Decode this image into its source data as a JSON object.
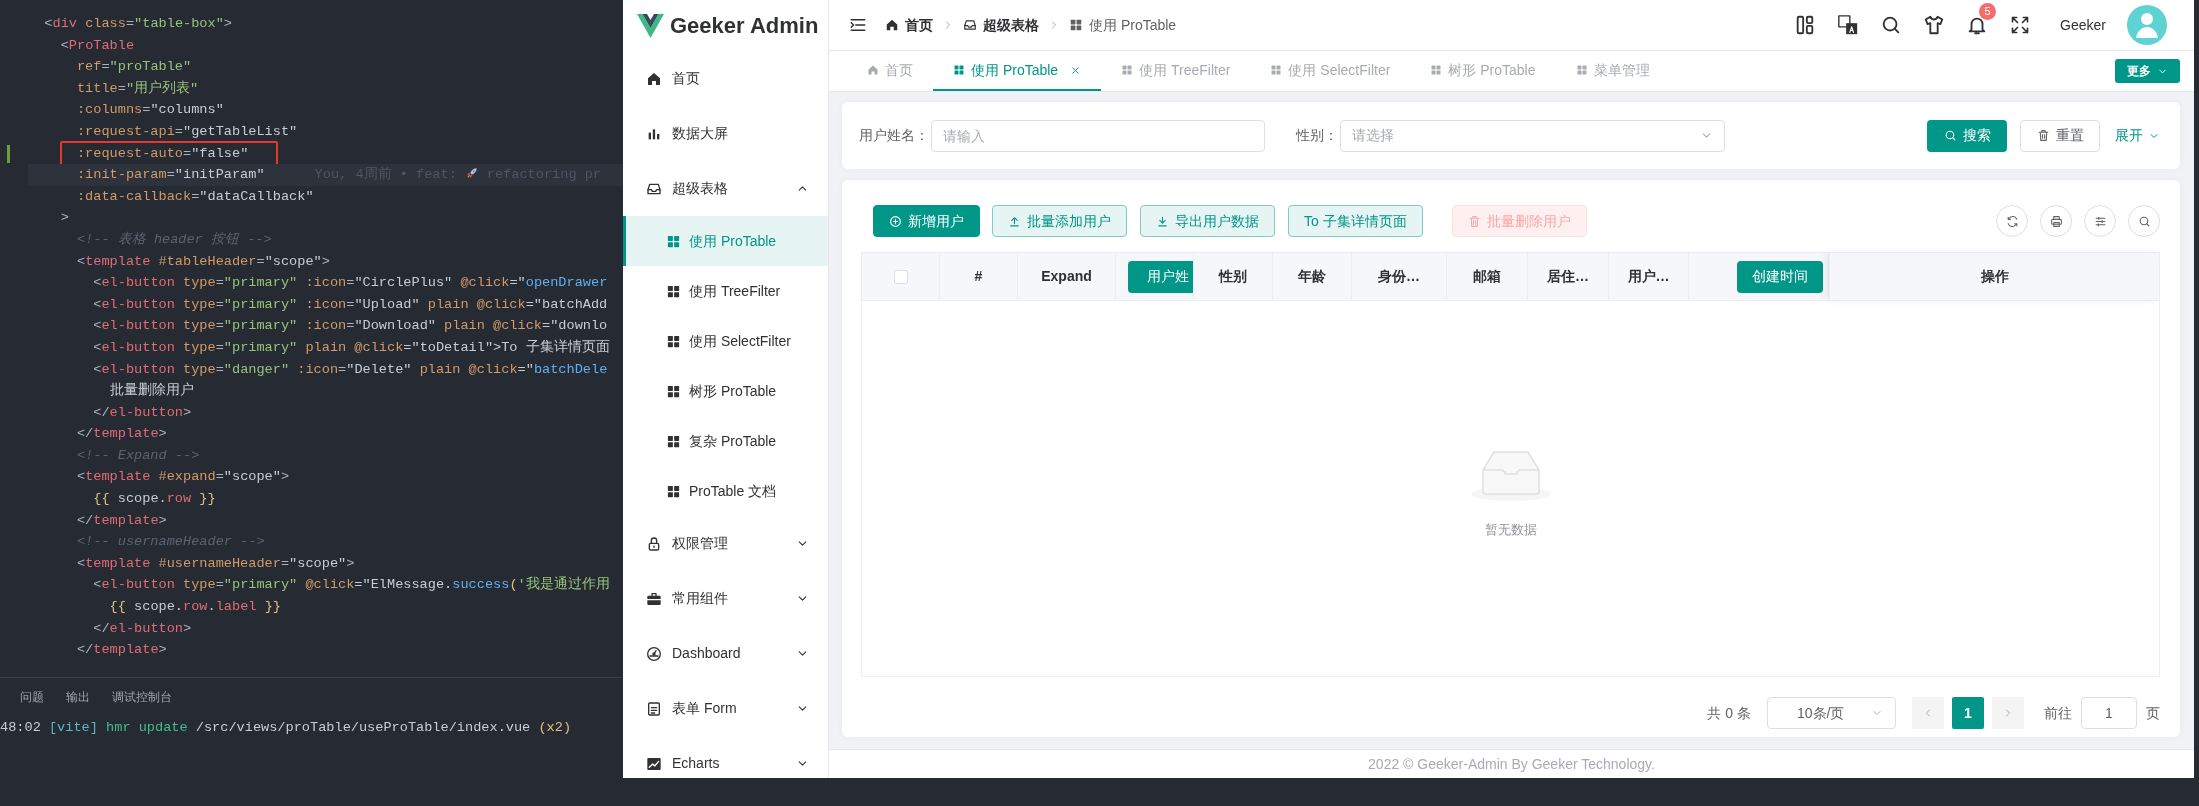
{
  "editor": {
    "lines": [
      {
        "kind": "plain",
        "segments": [
          {
            "t": "  <",
            "kind": "punct"
          },
          {
            "t": "div",
            "kind": "tag"
          },
          {
            "t": " class",
            "kind": "attr"
          },
          {
            "t": "=",
            "kind": "punct"
          },
          {
            "t": "\"table-box\"",
            "kind": "string"
          },
          {
            "t": ">",
            "kind": "punct"
          }
        ]
      },
      {
        "kind": "plain",
        "segments": [
          {
            "t": "    <",
            "kind": "punct"
          },
          {
            "t": "ProTable",
            "kind": "tag"
          }
        ]
      },
      {
        "kind": "plain",
        "segments": [
          {
            "t": "      ref",
            "kind": "attr"
          },
          {
            "t": "=",
            "kind": "punct"
          },
          {
            "t": "\"proTable\"",
            "kind": "string"
          }
        ]
      },
      {
        "kind": "plain",
        "segments": [
          {
            "t": "      title",
            "kind": "attr"
          },
          {
            "t": "=",
            "kind": "punct"
          },
          {
            "t": "\"用户列表\"",
            "kind": "string"
          }
        ]
      },
      {
        "kind": "plain",
        "segments": [
          {
            "t": "      :columns",
            "kind": "attr"
          },
          {
            "t": "=",
            "kind": "punct"
          },
          {
            "t": "\"columns\"",
            "kind": "plain"
          }
        ]
      },
      {
        "kind": "plain",
        "segments": [
          {
            "t": "      :request-api",
            "kind": "attr"
          },
          {
            "t": "=",
            "kind": "punct"
          },
          {
            "t": "\"getTableList\"",
            "kind": "plain"
          }
        ]
      },
      {
        "kind": "boxed",
        "segments": [
          {
            "t": "      :request-auto",
            "kind": "attr"
          },
          {
            "t": "=",
            "kind": "punct"
          },
          {
            "t": "\"false\"",
            "kind": "plain"
          }
        ]
      },
      {
        "kind": "current",
        "segments": [
          {
            "t": "      :init-param",
            "kind": "attr"
          },
          {
            "t": "=",
            "kind": "punct"
          },
          {
            "t": "\"initParam\"",
            "kind": "plain"
          }
        ],
        "blame": {
          "text": "You, 4周前 • feat:",
          "rest": "refactoring pr"
        }
      },
      {
        "kind": "plain",
        "segments": [
          {
            "t": "      :data-callback",
            "kind": "attr"
          },
          {
            "t": "=",
            "kind": "punct"
          },
          {
            "t": "\"dataCallback\"",
            "kind": "plain"
          }
        ]
      },
      {
        "kind": "plain",
        "segments": [
          {
            "t": "    >",
            "kind": "punct"
          }
        ]
      },
      {
        "kind": "plain",
        "segments": [
          {
            "t": "      <!-- 表格 header 按钮 -->",
            "kind": "comment"
          }
        ]
      },
      {
        "kind": "plain",
        "segments": [
          {
            "t": "      <",
            "kind": "punct"
          },
          {
            "t": "template",
            "kind": "tag"
          },
          {
            "t": " #tableHeader",
            "kind": "attr"
          },
          {
            "t": "=",
            "kind": "punct"
          },
          {
            "t": "\"scope\"",
            "kind": "plain"
          },
          {
            "t": ">",
            "kind": "punct"
          }
        ]
      },
      {
        "kind": "plain",
        "segments": [
          {
            "t": "        <",
            "kind": "punct"
          },
          {
            "t": "el-button",
            "kind": "tag"
          },
          {
            "t": " type",
            "kind": "attr"
          },
          {
            "t": "=",
            "kind": "punct"
          },
          {
            "t": "\"primary\"",
            "kind": "string"
          },
          {
            "t": " :icon",
            "kind": "attr"
          },
          {
            "t": "=",
            "kind": "punct"
          },
          {
            "t": "\"CirclePlus\"",
            "kind": "plain"
          },
          {
            "t": " @click",
            "kind": "attr"
          },
          {
            "t": "=\"",
            "kind": "plain"
          },
          {
            "t": "openDrawer",
            "kind": "function"
          }
        ]
      },
      {
        "kind": "plain",
        "segments": [
          {
            "t": "        <",
            "kind": "punct"
          },
          {
            "t": "el-button",
            "kind": "tag"
          },
          {
            "t": " type",
            "kind": "attr"
          },
          {
            "t": "=",
            "kind": "punct"
          },
          {
            "t": "\"primary\"",
            "kind": "string"
          },
          {
            "t": " :icon",
            "kind": "attr"
          },
          {
            "t": "=",
            "kind": "punct"
          },
          {
            "t": "\"Upload\"",
            "kind": "plain"
          },
          {
            "t": " plain @click",
            "kind": "attr"
          },
          {
            "t": "=\"batchAdd",
            "kind": "plain"
          }
        ]
      },
      {
        "kind": "plain",
        "segments": [
          {
            "t": "        <",
            "kind": "punct"
          },
          {
            "t": "el-button",
            "kind": "tag"
          },
          {
            "t": " type",
            "kind": "attr"
          },
          {
            "t": "=",
            "kind": "punct"
          },
          {
            "t": "\"primary\"",
            "kind": "string"
          },
          {
            "t": " :icon",
            "kind": "attr"
          },
          {
            "t": "=",
            "kind": "punct"
          },
          {
            "t": "\"Download\"",
            "kind": "plain"
          },
          {
            "t": " plain @click",
            "kind": "attr"
          },
          {
            "t": "=\"downlo",
            "kind": "plain"
          }
        ]
      },
      {
        "kind": "plain",
        "segments": [
          {
            "t": "        <",
            "kind": "punct"
          },
          {
            "t": "el-button",
            "kind": "tag"
          },
          {
            "t": " type",
            "kind": "attr"
          },
          {
            "t": "=",
            "kind": "punct"
          },
          {
            "t": "\"primary\"",
            "kind": "string"
          },
          {
            "t": " plain @click",
            "kind": "attr"
          },
          {
            "t": "=\"toDetail\">To 子集详情页面",
            "kind": "plain"
          }
        ]
      },
      {
        "kind": "plain",
        "segments": [
          {
            "t": "        <",
            "kind": "punct"
          },
          {
            "t": "el-button",
            "kind": "tag"
          },
          {
            "t": " type",
            "kind": "attr"
          },
          {
            "t": "=",
            "kind": "punct"
          },
          {
            "t": "\"danger\"",
            "kind": "string"
          },
          {
            "t": " :icon",
            "kind": "attr"
          },
          {
            "t": "=",
            "kind": "punct"
          },
          {
            "t": "\"Delete\"",
            "kind": "plain"
          },
          {
            "t": " plain @click",
            "kind": "attr"
          },
          {
            "t": "=\"",
            "kind": "plain"
          },
          {
            "t": "batchDele",
            "kind": "function"
          }
        ]
      },
      {
        "kind": "plain",
        "segments": [
          {
            "t": "          批量删除用户",
            "kind": "plain"
          }
        ]
      },
      {
        "kind": "plain",
        "segments": [
          {
            "t": "        </",
            "kind": "punct"
          },
          {
            "t": "el-button",
            "kind": "tag"
          },
          {
            "t": ">",
            "kind": "punct"
          }
        ]
      },
      {
        "kind": "plain",
        "segments": [
          {
            "t": "      </",
            "kind": "punct"
          },
          {
            "t": "template",
            "kind": "tag"
          },
          {
            "t": ">",
            "kind": "punct"
          }
        ]
      },
      {
        "kind": "plain",
        "segments": [
          {
            "t": "      <!-- Expand -->",
            "kind": "comment"
          }
        ]
      },
      {
        "kind": "plain",
        "segments": [
          {
            "t": "      <",
            "kind": "punct"
          },
          {
            "t": "template",
            "kind": "tag"
          },
          {
            "t": " #expand",
            "kind": "attr"
          },
          {
            "t": "=",
            "kind": "punct"
          },
          {
            "t": "\"scope\"",
            "kind": "plain"
          },
          {
            "t": ">",
            "kind": "punct"
          }
        ]
      },
      {
        "kind": "plain",
        "segments": [
          {
            "t": "        {{",
            "kind": "brace"
          },
          {
            "t": " scope.",
            "kind": "plain"
          },
          {
            "t": "row",
            "kind": "property"
          },
          {
            "t": " }}",
            "kind": "brace"
          }
        ]
      },
      {
        "kind": "plain",
        "segments": [
          {
            "t": "      </",
            "kind": "punct"
          },
          {
            "t": "template",
            "kind": "tag"
          },
          {
            "t": ">",
            "kind": "punct"
          }
        ]
      },
      {
        "kind": "plain",
        "segments": [
          {
            "t": "      <!-- usernameHeader -->",
            "kind": "comment"
          }
        ]
      },
      {
        "kind": "plain",
        "segments": [
          {
            "t": "      <",
            "kind": "punct"
          },
          {
            "t": "template",
            "kind": "tag"
          },
          {
            "t": " #usernameHeader",
            "kind": "attr"
          },
          {
            "t": "=",
            "kind": "punct"
          },
          {
            "t": "\"scope\"",
            "kind": "plain"
          },
          {
            "t": ">",
            "kind": "punct"
          }
        ]
      },
      {
        "kind": "plain",
        "segments": [
          {
            "t": "        <",
            "kind": "punct"
          },
          {
            "t": "el-button",
            "kind": "tag"
          },
          {
            "t": " type",
            "kind": "attr"
          },
          {
            "t": "=",
            "kind": "punct"
          },
          {
            "t": "\"primary\"",
            "kind": "string"
          },
          {
            "t": " @click",
            "kind": "attr"
          },
          {
            "t": "=\"ElMessage.",
            "kind": "plain"
          },
          {
            "t": "success",
            "kind": "function"
          },
          {
            "t": "(",
            "kind": "brace"
          },
          {
            "t": "'我是通过作用",
            "kind": "string"
          }
        ]
      },
      {
        "kind": "plain",
        "segments": [
          {
            "t": "          {{",
            "kind": "brace"
          },
          {
            "t": " scope.",
            "kind": "plain"
          },
          {
            "t": "row",
            "kind": "property"
          },
          {
            "t": ".",
            "kind": "plain"
          },
          {
            "t": "label",
            "kind": "property"
          },
          {
            "t": " }}",
            "kind": "brace"
          }
        ]
      },
      {
        "kind": "plain",
        "segments": [
          {
            "t": "        </",
            "kind": "punct"
          },
          {
            "t": "el-button",
            "kind": "tag"
          },
          {
            "t": ">",
            "kind": "punct"
          }
        ]
      },
      {
        "kind": "plain",
        "segments": [
          {
            "t": "      </",
            "kind": "punct"
          },
          {
            "t": "template",
            "kind": "tag"
          },
          {
            "t": ">",
            "kind": "punct"
          }
        ]
      }
    ],
    "panel_tabs": [
      "问题",
      "输出",
      "调试控制台"
    ],
    "terminal": [
      {
        "t": "48:02 ",
        "kind": "plain"
      },
      {
        "t": "[vite]",
        "kind": "info"
      },
      {
        "t": " hmr update",
        "kind": "keyword"
      },
      {
        "t": " /src/views/proTable/useProTable/index.vue ",
        "kind": "plain"
      },
      {
        "t": "(x2)",
        "kind": "brace"
      }
    ]
  },
  "app": {
    "logo": "Geeker Admin",
    "sidebar": {
      "items": [
        {
          "kind": "link",
          "label": "首页"
        },
        {
          "kind": "link",
          "label": "数据大屏"
        },
        {
          "kind": "group",
          "label": "超级表格",
          "expanded": true,
          "children": [
            {
              "label": "使用 ProTable",
              "selected": true
            },
            {
              "label": "使用 TreeFilter",
              "selected": false
            },
            {
              "label": "使用 SelectFilter",
              "selected": false
            },
            {
              "label": "树形 ProTable",
              "selected": false
            },
            {
              "label": "复杂 ProTable",
              "selected": false
            },
            {
              "label": "ProTable 文档",
              "selected": false
            }
          ]
        },
        {
          "kind": "group",
          "label": "权限管理",
          "expanded": false
        },
        {
          "kind": "group",
          "label": "常用组件",
          "expanded": false
        },
        {
          "kind": "group",
          "label": "Dashboard",
          "expanded": false
        },
        {
          "kind": "group",
          "label": "表单 Form",
          "expanded": false
        },
        {
          "kind": "group",
          "label": "Echarts",
          "expanded": false
        }
      ]
    },
    "breadcrumb": [
      "首页",
      "超级表格",
      "使用 ProTable"
    ],
    "notification_badge": "5",
    "user_name": "Geeker",
    "tabs": [
      {
        "label": "首页",
        "selected": false
      },
      {
        "label": "使用 ProTable",
        "selected": true
      },
      {
        "label": "使用 TreeFilter",
        "selected": false
      },
      {
        "label": "使用 SelectFilter",
        "selected": false
      },
      {
        "label": "树形 ProTable",
        "selected": false
      },
      {
        "label": "菜单管理",
        "selected": false
      }
    ],
    "more_button": "更多",
    "search": {
      "fields": [
        {
          "kind": "input",
          "label": "用户姓名：",
          "placeholder": "请输入"
        },
        {
          "kind": "select",
          "label": "性别：",
          "placeholder": "请选择"
        }
      ],
      "search_button": "搜索",
      "reset_button": "重置",
      "expand_link": "展开"
    },
    "toolbar": [
      {
        "label": "新增用户",
        "kind": "primary",
        "disabled": false
      },
      {
        "label": "批量添加用户",
        "kind": "plain",
        "disabled": false
      },
      {
        "label": "导出用户数据",
        "kind": "plain",
        "disabled": false
      },
      {
        "label": "To 子集详情页面",
        "kind": "plain",
        "disabled": false
      },
      {
        "label": "批量删除用户",
        "kind": "danger",
        "disabled": true
      }
    ],
    "table": {
      "columns": [
        {
          "kind": "checkbox",
          "checked": false
        },
        {
          "kind": "text",
          "label": "#"
        },
        {
          "kind": "text",
          "label": "Expand"
        },
        {
          "kind": "button",
          "label": "用户姓"
        },
        {
          "kind": "text",
          "label": "性别"
        },
        {
          "kind": "text",
          "label": "年龄"
        },
        {
          "kind": "text",
          "label": "身份…"
        },
        {
          "kind": "text",
          "label": "邮箱"
        },
        {
          "kind": "text",
          "label": "居住…"
        },
        {
          "kind": "text",
          "label": "用户…"
        },
        {
          "kind": "button",
          "label": "创建时间"
        },
        {
          "kind": "text",
          "label": "操作"
        }
      ],
      "empty_text": "暂无数据"
    },
    "pagination": {
      "total": "共 0 条",
      "page_size": "10条/页",
      "pages": [
        {
          "label": "1",
          "selected": true
        }
      ],
      "goto_label": "前往",
      "goto_value": "1",
      "page_suffix": "页"
    },
    "footer": "2022 © Geeker-Admin By Geeker Technology."
  }
}
